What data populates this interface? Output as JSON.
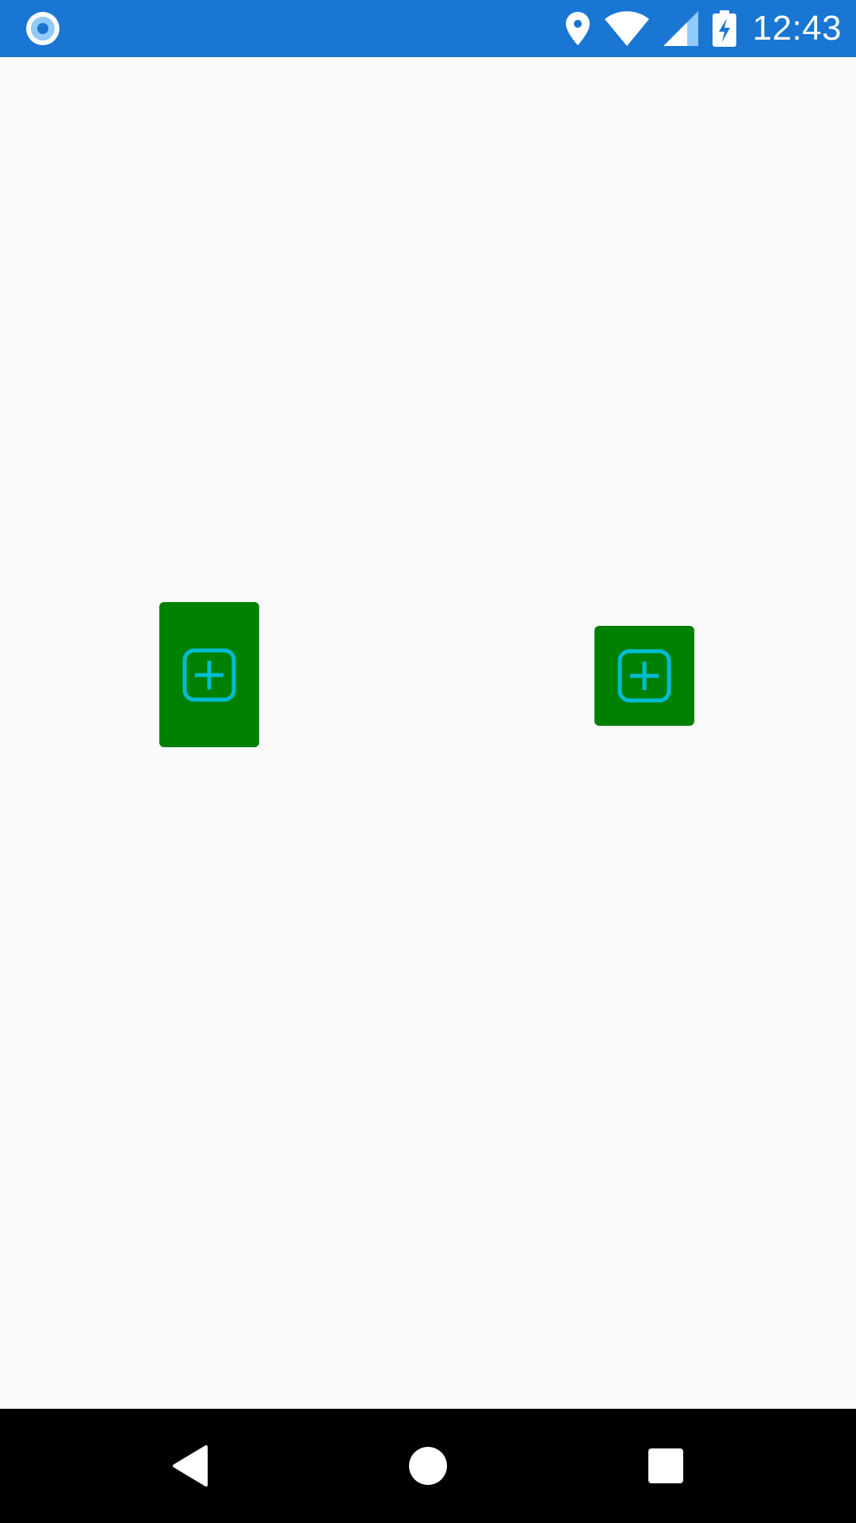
{
  "status_bar": {
    "time": "12:43",
    "icons": [
      "app-notification-icon",
      "location-icon",
      "wifi-icon",
      "cellular-signal-icon",
      "battery-charging-icon"
    ]
  },
  "content": {
    "buttons": [
      {
        "icon": "add-box-icon",
        "background": "#008000",
        "icon_color": "#00bcd4"
      },
      {
        "icon": "add-box-icon",
        "background": "#008000",
        "icon_color": "#00bcd4"
      }
    ]
  },
  "navigation_bar": {
    "buttons": [
      "back-icon",
      "home-icon",
      "recents-icon"
    ]
  },
  "colors": {
    "status_bar": "#1976d2",
    "background": "#fafafa",
    "button": "#008000",
    "icon": "#00bcd4",
    "nav_bar": "#000000"
  }
}
